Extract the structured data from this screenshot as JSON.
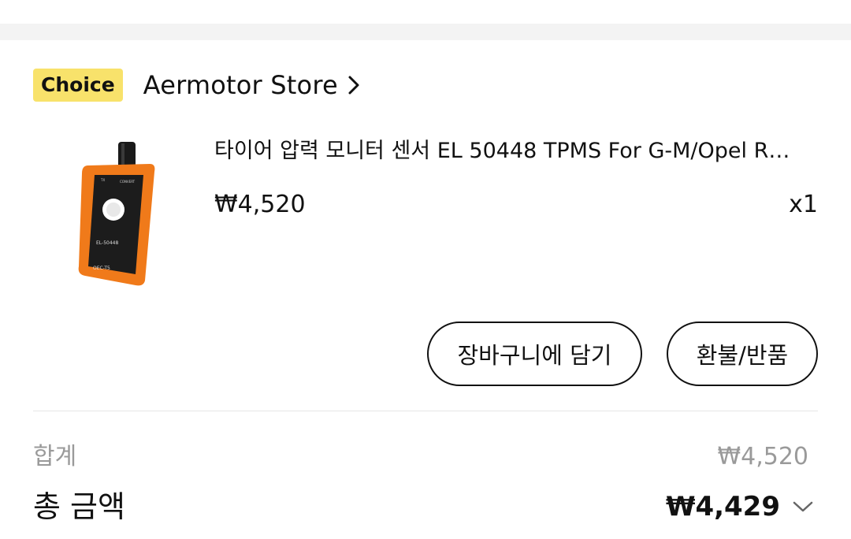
{
  "store": {
    "badge": "Choice",
    "name": "Aermotor Store"
  },
  "product": {
    "title": "타이어 압력 모니터 센서 EL 50448 TPMS For G-M/Opel R…",
    "price": "₩4,520",
    "quantity": "x1",
    "image": {
      "device_label": "EL-50448",
      "brand_label": "OEC-T5",
      "button_left": "TX",
      "button_right": "CONVERT",
      "color": "#f07a1a"
    }
  },
  "actions": {
    "add_to_cart": "장바구니에 담기",
    "refund": "환불/반품"
  },
  "summary": {
    "subtotal_label": "합계",
    "subtotal_value": "₩4,520",
    "total_label": "총 금액",
    "total_value": "₩4,429"
  },
  "icons": {
    "store_link": "chevron-right-icon",
    "expand_total": "chevron-down-icon"
  }
}
